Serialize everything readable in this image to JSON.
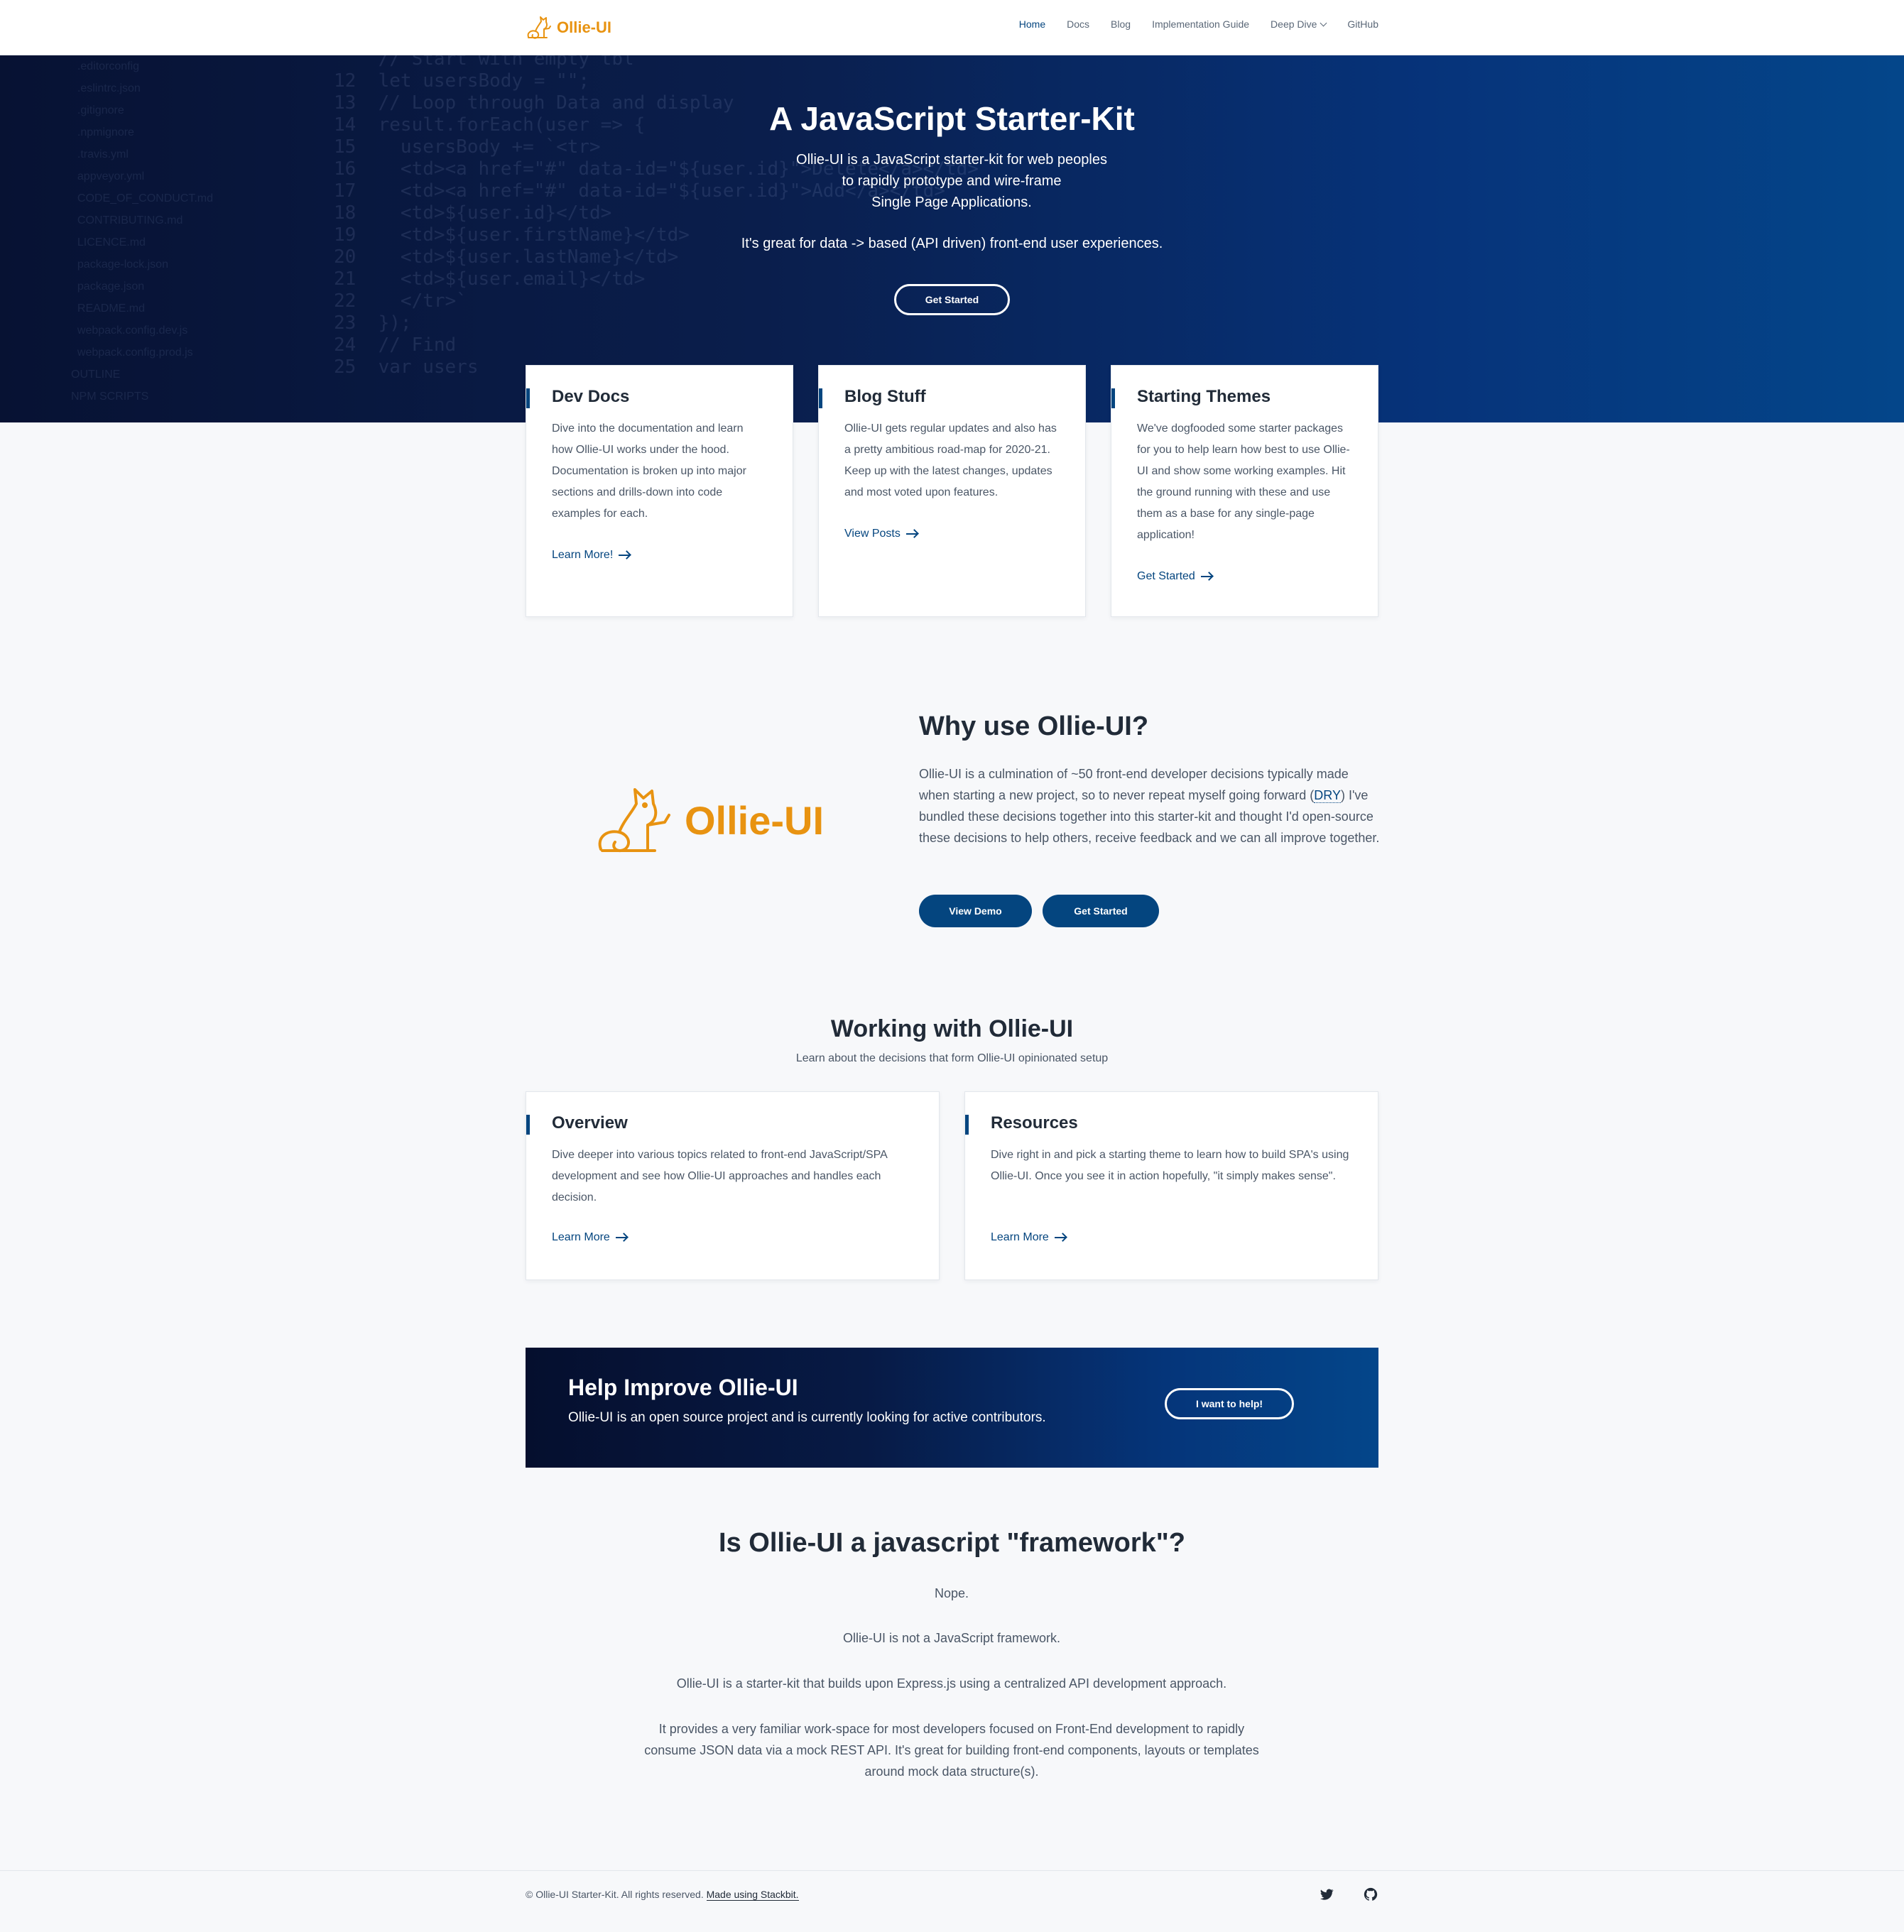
{
  "header": {
    "brand": "Ollie-UI",
    "nav": [
      {
        "label": "Home",
        "active": true
      },
      {
        "label": "Docs"
      },
      {
        "label": "Blog"
      },
      {
        "label": "Implementation Guide"
      },
      {
        "label": "Deep Dive",
        "dropdown": true
      },
      {
        "label": "GitHub"
      }
    ]
  },
  "hero": {
    "title": "A JavaScript Starter-Kit",
    "subtitle_lines": [
      "Ollie-UI is a JavaScript starter-kit for web peoples",
      "to rapidly prototype and wire-frame",
      "Single Page Applications."
    ],
    "subtitle2": "It's great for data -> based (API driven) front-end user experiences.",
    "button": "Get Started"
  },
  "cards": [
    {
      "title": "Dev Docs",
      "text": "Dive into the documentation and learn how Ollie-UI works under the hood. Documentation is broken up into major sections and drills-down into code examples for each.",
      "link": "Learn More!"
    },
    {
      "title": "Blog Stuff",
      "text": "Ollie-UI gets regular updates and also has a pretty ambitious road-map for 2020-21. Keep up with the latest changes, updates and most voted upon features.",
      "link": "View Posts"
    },
    {
      "title": "Starting Themes",
      "text": "We've dogfooded some starter packages for you to help learn how best to use Ollie-UI and show some working examples. Hit the ground running with these and use them as a base for any single-page application!",
      "link": "Get Started"
    }
  ],
  "why": {
    "logo_text": "Ollie-UI",
    "title": "Why use Ollie-UI?",
    "text_before": "Ollie-UI is a culmination of ~50 front-end developer decisions typically made when starting a new project, so to never repeat myself going forward (",
    "text_link": "DRY",
    "text_after": ") I've bundled these decisions together into this starter-kit and thought I'd open-source these decisions to help others, receive feedback and we can all improve together.",
    "button_demo": "View Demo",
    "button_start": "Get Started"
  },
  "working": {
    "title": "Working with Ollie-UI",
    "subtitle": "Learn about the decisions that form Ollie-UI opinionated setup",
    "cards": [
      {
        "title": "Overview",
        "text": "Dive deeper into various topics related to front-end JavaScript/SPA development and see how Ollie-UI approaches and handles each decision.",
        "link": "Learn More"
      },
      {
        "title": "Resources",
        "text": "Dive right in and pick a starting theme to learn how to build SPA's using Ollie-UI. Once you see it in action hopefully, \"it simply makes sense\".",
        "link": "Learn More"
      }
    ]
  },
  "cta": {
    "title": "Help Improve Ollie-UI",
    "text": "Ollie-UI is an open source project and is currently looking for active contributors.",
    "button": "I want to help!"
  },
  "framework": {
    "title": "Is Ollie-UI a javascript \"framework\"?",
    "paragraphs": [
      "Nope.",
      "Ollie-UI is not a JavaScript framework.",
      "Ollie-UI is a starter-kit that builds upon Express.js using a centralized API development approach.",
      "It provides a very familiar work-space for most developers focused on Front-End development to rapidly consume JSON data via a mock REST API. It's great for building front-end components, layouts or templates around mock data structure(s)."
    ]
  },
  "footer": {
    "copyright": "© Ollie-UI Starter-Kit. All rights reserved.",
    "link": "Made using Stackbit.",
    "icons": [
      "twitter-icon",
      "github-icon"
    ]
  },
  "colors": {
    "brand_orange": "#e89311",
    "accent_blue": "#04457f",
    "hero_dark": "#071233"
  }
}
